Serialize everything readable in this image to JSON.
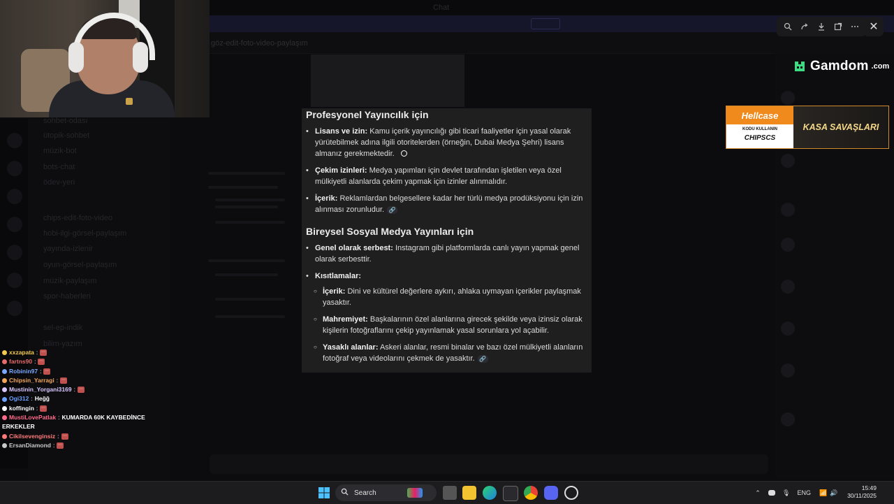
{
  "background": {
    "window_title": "Chat",
    "channel_header": "göz-edit-foto-video-paylaşım",
    "channels": [
      "sohbet-odası",
      "ütopik-sohbet",
      "müzik-bot",
      "bots-chat",
      "ödev-yeri",
      "chips-edit-foto-video",
      "hobi-ilgi-görsel-paylaşım",
      "yayında-izlenir",
      "oyun-görsel-paylaşım",
      "müzik-paylaşım",
      "spor-haberleri",
      "sel-ep-indik",
      "bilim-yazım"
    ]
  },
  "chat": [
    {
      "user": "xxzapata",
      "msg": "",
      "color": "#f2c94c"
    },
    {
      "user": "fartns90",
      "msg": "",
      "color": "#e86a6a"
    },
    {
      "user": "Robinin97",
      "msg": "",
      "color": "#7aa8ff"
    },
    {
      "user": "Chipsin_Yarragi",
      "msg": "",
      "color": "#f2a65a"
    },
    {
      "user": "Mustinin_Yorgani3169",
      "msg": "",
      "color": "#d9c7ff"
    },
    {
      "user": "Ogi312",
      "msg": "Heğğ",
      "color": "#6aa0ff"
    },
    {
      "user": "koffingin",
      "msg": "",
      "color": "#ffffff"
    },
    {
      "user": "MustiLovePatlak",
      "msg": "KUMARDA 60K KAYBEDİNCE",
      "color": "#ff6a8a"
    },
    {
      "user": "",
      "msg": "ERKEKLER",
      "color": "#ffffff"
    },
    {
      "user": "Cikilsevenginsiz",
      "msg": "",
      "color": "#ff7a7a"
    },
    {
      "user": "ErsanDiamond",
      "msg": "",
      "color": "#c8c8c8"
    }
  ],
  "viewer": {
    "toolbar": [
      "zoom-icon",
      "share-icon",
      "download-icon",
      "open-external-icon",
      "more-icon"
    ],
    "close": "✕"
  },
  "sponsors": {
    "gamdom_name": "Gamdom",
    "gamdom_tld": ".com",
    "hellcase_logo": "Hellcase",
    "hellcase_kodu": "KODU KULLANIN",
    "hellcase_code": "CHIPSCS",
    "hellcase_tagline": "KASA SAVAŞLARI"
  },
  "content": {
    "section1_title": "Profesyonel Yayıncılık için",
    "s1_items": [
      {
        "bold": "Lisans ve izin:",
        "text": " Kamu içerik yayıncılığı gibi ticari faaliyetler için yasal olarak yürütebilmek adına ilgili otoritelerden (örneğin, Dubai Medya Şehri) lisans almanız gerekmektedir."
      },
      {
        "bold": "Çekim izinleri:",
        "text": " Medya yapımları için devlet tarafından işletilen veya özel mülkiyetli alanlarda çekim yapmak için izinler alınmalıdır."
      },
      {
        "bold": "İçerik:",
        "text": " Reklamlardan belgesellere kadar her türlü medya prodüksiyonu için izin alınması zorunludur."
      }
    ],
    "section2_title": "Bireysel Sosyal Medya Yayınları için",
    "s2_item1_bold": "Genel olarak serbest:",
    "s2_item1_text": " Instagram gibi platformlarda canlı yayın yapmak genel olarak serbesttir.",
    "s2_item2_bold": "Kısıtlamalar:",
    "s2_subs": [
      {
        "bold": "İçerik:",
        "text": " Dini ve kültürel değerlere aykırı, ahlaka uymayan içerikler paylaşmak yasaktır."
      },
      {
        "bold": "Mahremiyet:",
        "text": " Başkalarının özel alanlarına girecek şekilde veya izinsiz olarak kişilerin fotoğraflarını çekip yayınlamak yasal sorunlara yol açabilir."
      },
      {
        "bold": "Yasaklı alanlar:",
        "text": " Askeri alanlar, resmi binalar ve bazı özel mülkiyetli alanların fotoğraf veya videolarını çekmek de yasaktır."
      }
    ]
  },
  "taskbar": {
    "search_label": "Search",
    "lang": "ENG",
    "time": "15:49",
    "date": "30/11/2025"
  }
}
